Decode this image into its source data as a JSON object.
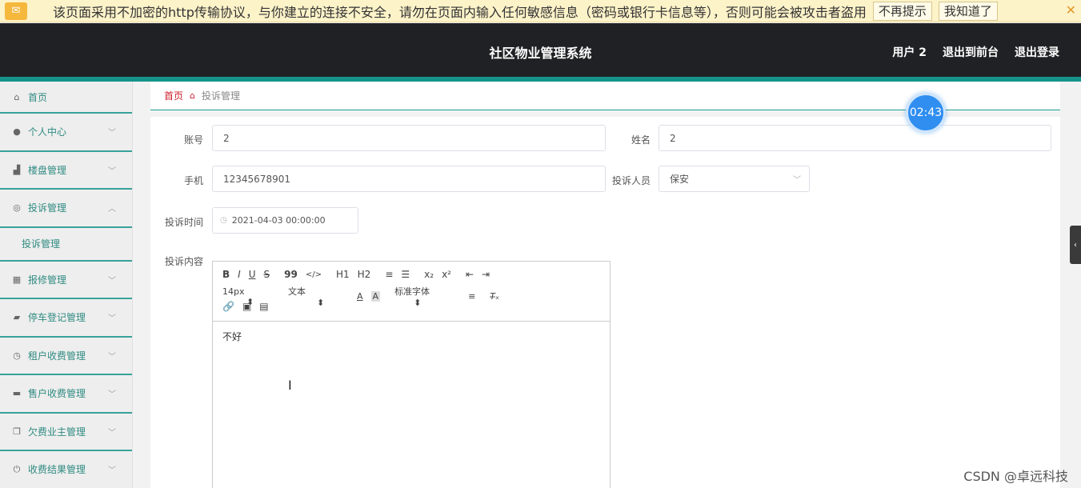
{
  "warning": {
    "icon": "warning-icon",
    "text": "该页面采用不加密的http传输协议，与你建立的连接不安全，请勿在页面内输入任何敏感信息（密码或银行卡信息等），否则可能会被攻击者盗用",
    "btn_dismiss": "不再提示",
    "btn_ok": "我知道了",
    "close": "✕"
  },
  "header": {
    "title": "社区物业管理系统",
    "user": "用户 2",
    "to_front": "退出到前台",
    "logout": "退出登录"
  },
  "sidebar": {
    "items": [
      {
        "label": "首页",
        "icon": "home-icon"
      },
      {
        "label": "个人中心",
        "icon": "user-icon"
      },
      {
        "label": "楼盘管理",
        "icon": "building-icon"
      },
      {
        "label": "投诉管理",
        "icon": "complaint-icon"
      },
      {
        "label": "投诉管理",
        "icon": ""
      },
      {
        "label": "报修管理",
        "icon": "grid-icon"
      },
      {
        "label": "停车登记管理",
        "icon": "parking-icon"
      },
      {
        "label": "租户收费管理",
        "icon": "clock-icon"
      },
      {
        "label": "售户收费管理",
        "icon": "printer-icon"
      },
      {
        "label": "欠费业主管理",
        "icon": "copy-icon"
      },
      {
        "label": "收费结果管理",
        "icon": "power-icon"
      }
    ]
  },
  "breadcrumb": {
    "home": "首页",
    "current": "投诉管理"
  },
  "form": {
    "account_label": "账号",
    "account_value": "2",
    "name_label": "姓名",
    "name_value": "2",
    "phone_label": "手机",
    "phone_value": "12345678901",
    "staff_label": "投诉人员",
    "staff_value": "保安",
    "time_label": "投诉时间",
    "time_value": "2021-04-03 00:00:00",
    "content_label": "投诉内容"
  },
  "editor": {
    "row1": [
      "B",
      "I",
      "U",
      "S",
      "99",
      "</>",
      "H1",
      "H2",
      "≡",
      "☰",
      "x₂",
      "x²",
      "⇤",
      "⇥"
    ],
    "font_size": "14px",
    "text_style": "文本",
    "font_family": "标准字体",
    "body": "不好"
  },
  "timer": "02:43",
  "watermark": "CSDN @卓远科技"
}
